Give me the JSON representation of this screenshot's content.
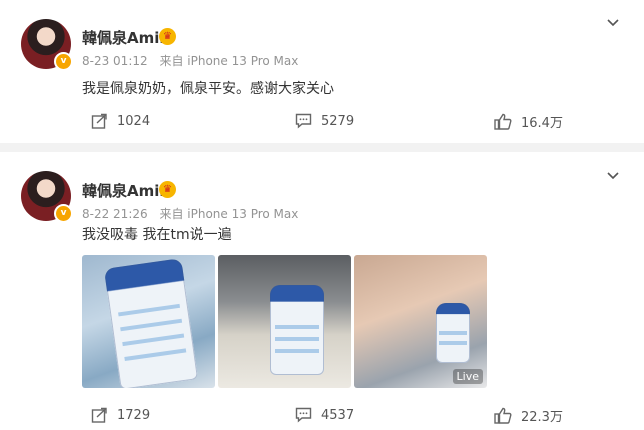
{
  "posts": [
    {
      "username": "韓佩泉Amir",
      "time": "8-23 01:12",
      "source": "来自 iPhone 13 Pro Max",
      "text": "我是佩泉奶奶，佩泉平安。感谢大家关心",
      "reposts": "1024",
      "comments": "5279",
      "likes": "16.4万"
    },
    {
      "username": "韓佩泉Amir",
      "time": "8-22 21:26",
      "source": "来自 iPhone 13 Pro Max",
      "text": "我没吸毒 我在tm说一遍",
      "reposts": "1729",
      "comments": "4537",
      "likes": "22.3万",
      "live_label": "Live"
    }
  ],
  "icons": {
    "verified": "v-badge",
    "crown": "crown-icon",
    "menu": "chevron-down-icon",
    "repost": "share-icon",
    "comment": "comment-icon",
    "like": "thumb-up-icon"
  }
}
